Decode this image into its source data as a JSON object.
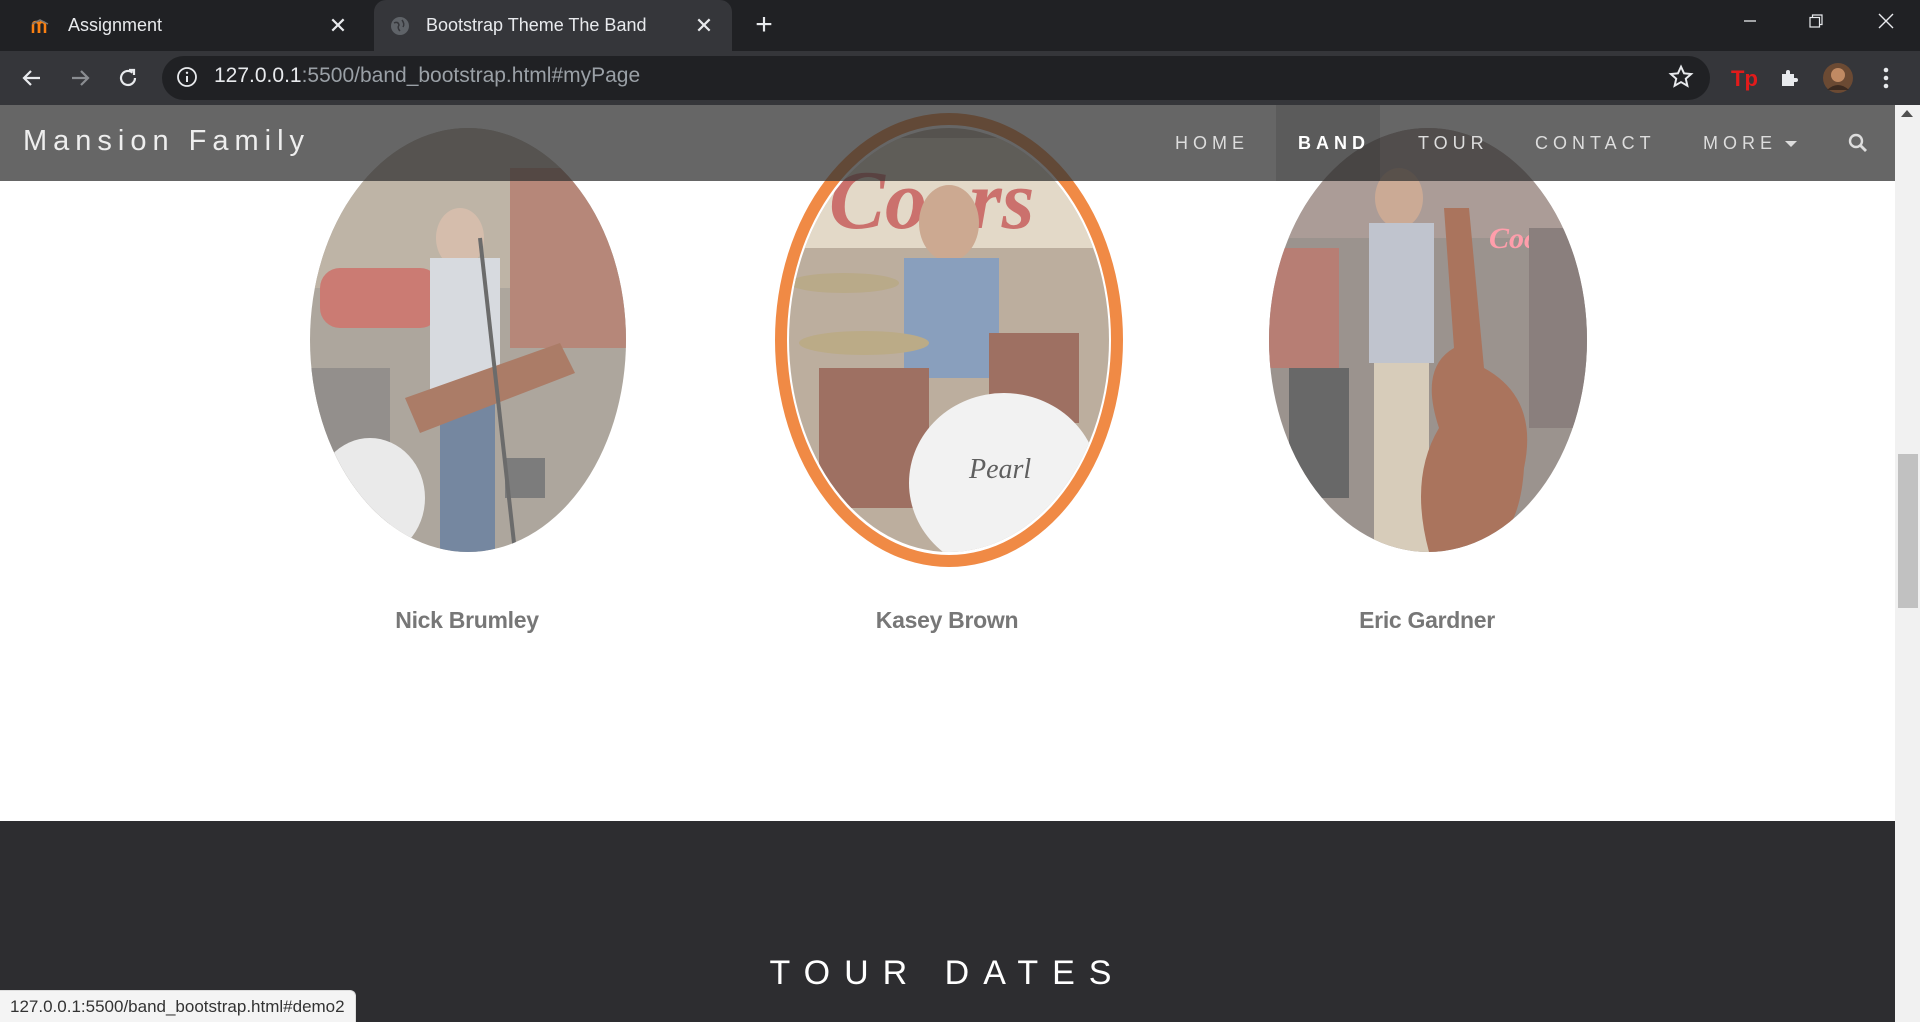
{
  "browser": {
    "tabs": [
      {
        "title": "Assignment",
        "icon": "moodle-icon",
        "active": false
      },
      {
        "title": "Bootstrap Theme The Band",
        "icon": "globe-icon",
        "active": true
      }
    ],
    "url_host": "127.0.0.1",
    "url_rest": ":5500/band_bootstrap.html#myPage",
    "status_url": "127.0.0.1:5500/band_bootstrap.html#demo2"
  },
  "navbar": {
    "brand": "Mansion Family",
    "items": [
      "HOME",
      "BAND",
      "TOUR",
      "CONTACT",
      "MORE"
    ],
    "active": "BAND"
  },
  "members": [
    {
      "name": "Nick Brumley",
      "role_icon": "guitarist-photo"
    },
    {
      "name": "Kasey Brown",
      "role_icon": "drummer-photo"
    },
    {
      "name": "Eric Gardner",
      "role_icon": "bassist-photo"
    }
  ],
  "tour": {
    "title": "TOUR DATES"
  },
  "colors": {
    "accent": "#f08a45",
    "navbar": "#333333",
    "dark_section": "#2d2d30"
  }
}
